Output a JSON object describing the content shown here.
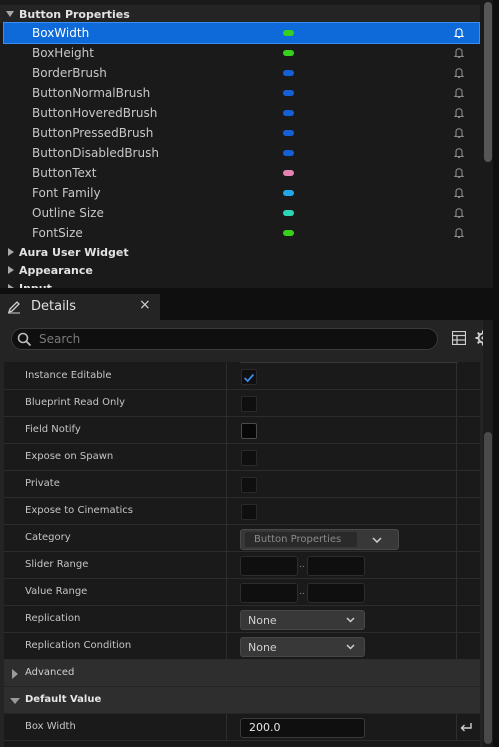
{
  "variables_panel": {
    "category": "Button Properties",
    "items": [
      {
        "name": "BoxWidth",
        "type_color": "#35d11d",
        "selected": true
      },
      {
        "name": "BoxHeight",
        "type_color": "#35d11d",
        "selected": false
      },
      {
        "name": "BorderBrush",
        "type_color": "#1560d6",
        "selected": false
      },
      {
        "name": "ButtonNormalBrush",
        "type_color": "#1560d6",
        "selected": false
      },
      {
        "name": "ButtonHoveredBrush",
        "type_color": "#1560d6",
        "selected": false
      },
      {
        "name": "ButtonPressedBrush",
        "type_color": "#1560d6",
        "selected": false
      },
      {
        "name": "ButtonDisabledBrush",
        "type_color": "#1560d6",
        "selected": false
      },
      {
        "name": "ButtonText",
        "type_color": "#e682b0",
        "selected": false
      },
      {
        "name": "Font Family",
        "type_color": "#22a6e8",
        "selected": false
      },
      {
        "name": "Outline Size",
        "type_color": "#2ad6b5",
        "selected": false
      },
      {
        "name": "FontSize",
        "type_color": "#35d11d",
        "selected": false
      }
    ],
    "collapsed_categories": [
      "Aura User Widget",
      "Appearance",
      "Input"
    ]
  },
  "details": {
    "tab_label": "Details",
    "close_glyph": "×",
    "search_placeholder": "Search",
    "properties": [
      {
        "label": "Instance Editable",
        "kind": "checkbox",
        "checked": true
      },
      {
        "label": "Blueprint Read Only",
        "kind": "checkbox",
        "checked": false
      },
      {
        "label": "Field Notify",
        "kind": "checkbox",
        "checked": false
      },
      {
        "label": "Expose on Spawn",
        "kind": "checkbox",
        "checked": false
      },
      {
        "label": "Private",
        "kind": "checkbox",
        "checked": false
      },
      {
        "label": "Expose to Cinematics",
        "kind": "checkbox",
        "checked": false
      },
      {
        "label": "Category",
        "kind": "category",
        "value": "Button Properties"
      },
      {
        "label": "Slider Range",
        "kind": "range",
        "separator": ".."
      },
      {
        "label": "Value Range",
        "kind": "range",
        "separator": ".."
      },
      {
        "label": "Replication",
        "kind": "combo",
        "value": "None"
      },
      {
        "label": "Replication Condition",
        "kind": "combo",
        "value": "None"
      }
    ],
    "advanced_label": "Advanced",
    "default_value_label": "Default Value",
    "box_width_label": "Box Width",
    "box_width_value": "200.0"
  },
  "colors": {
    "selection": "#0e6ad8",
    "panel_bg": "#1a1a1a",
    "header_bg": "#242424"
  }
}
